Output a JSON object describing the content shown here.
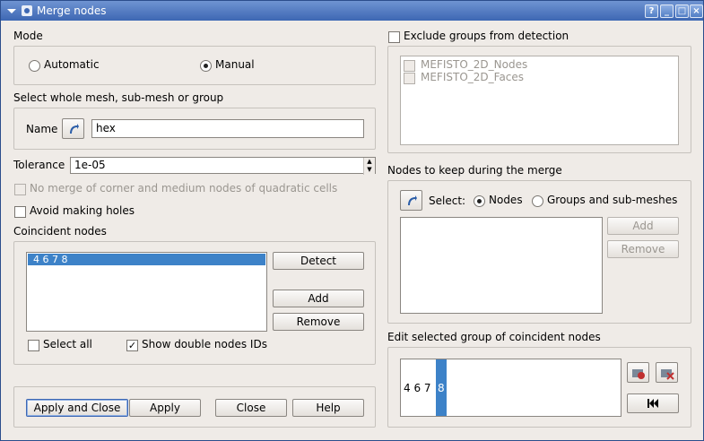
{
  "window": {
    "title": "Merge nodes"
  },
  "mode": {
    "title": "Mode",
    "automatic": "Automatic",
    "manual": "Manual",
    "selected": "Manual"
  },
  "select_mesh": {
    "title": "Select whole mesh, sub-mesh or group",
    "name_label": "Name",
    "name_value": "hex"
  },
  "tolerance": {
    "label": "Tolerance",
    "value": "1e-05"
  },
  "options": {
    "no_merge_corner": "No merge of corner and medium nodes of quadratic cells",
    "avoid_holes": "Avoid making holes"
  },
  "coincident": {
    "title": "Coincident nodes",
    "items": [
      "4 6 7 8"
    ],
    "detect": "Detect",
    "add": "Add",
    "remove": "Remove",
    "select_all": "Select all",
    "show_ids": "Show double nodes IDs"
  },
  "exclude": {
    "title": "Exclude groups from detection",
    "groups": [
      "MEFISTO_2D_Nodes",
      "MEFISTO_2D_Faces"
    ]
  },
  "keep": {
    "title": "Nodes to keep during the merge",
    "select_label": "Select:",
    "nodes": "Nodes",
    "groups": "Groups and sub-meshes",
    "add": "Add",
    "remove": "Remove"
  },
  "edit_group": {
    "title": "Edit selected group of coincident nodes",
    "prefix": "4 6 7",
    "selected": "8"
  },
  "buttons": {
    "apply_close": "Apply and Close",
    "apply": "Apply",
    "close": "Close",
    "help": "Help"
  }
}
